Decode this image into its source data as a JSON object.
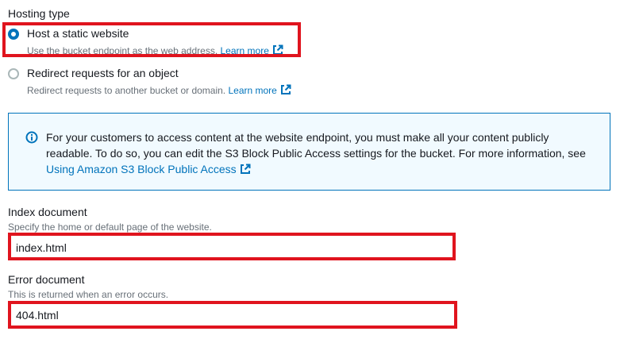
{
  "hosting_type": {
    "label": "Hosting type",
    "options": [
      {
        "title": "Host a static website",
        "description": "Use the bucket endpoint as the web address.",
        "link": "Learn more",
        "selected": true
      },
      {
        "title": "Redirect requests for an object",
        "description": "Redirect requests to another bucket or domain.",
        "link": "Learn more",
        "selected": false
      }
    ]
  },
  "info_alert": {
    "text": "For your customers to access content at the website endpoint, you must make all your content publicly readable. To do so, you can edit the S3 Block Public Access settings for the bucket. For more information, see",
    "link": "Using Amazon S3 Block Public Access"
  },
  "index_document": {
    "label": "Index document",
    "description": "Specify the home or default page of the website.",
    "value": "index.html"
  },
  "error_document": {
    "label": "Error document",
    "description": "This is returned when an error occurs.",
    "value": "404.html"
  },
  "colors": {
    "accent": "#0073bb",
    "highlight": "#e0141e",
    "alert_background": "#f1faff"
  },
  "icons": [
    "external-link-icon",
    "info-icon"
  ]
}
